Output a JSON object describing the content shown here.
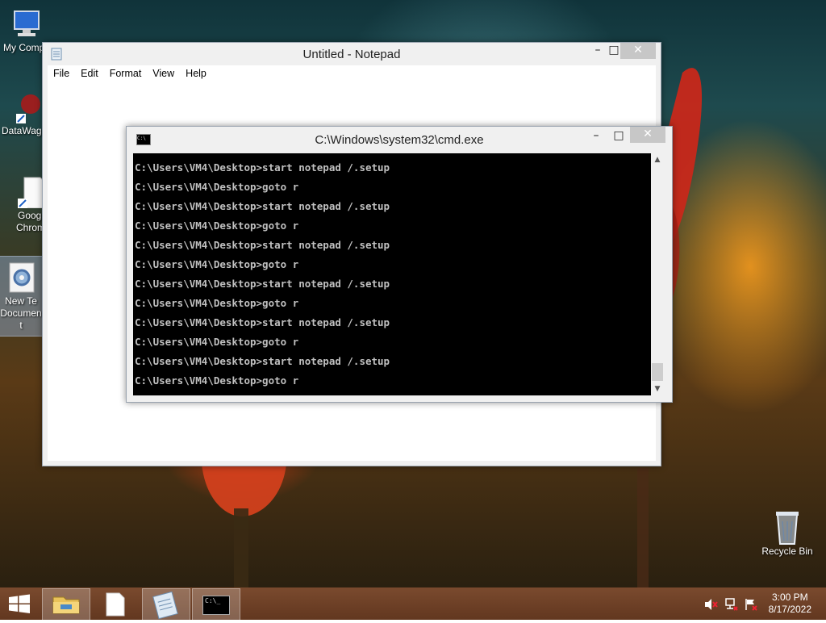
{
  "desktop": {
    "icons": [
      {
        "label": "My Comp",
        "icon": "computer-icon"
      },
      {
        "label": "DataWag",
        "icon": "datawag-shortcut-icon"
      },
      {
        "label_line1": "Googl",
        "label_line2": "Chrom",
        "icon": "chrome-shortcut-icon"
      },
      {
        "label_line1": "New Te",
        "label_line2": "Documen",
        "label_line3": "t",
        "icon": "text-document-gear-icon"
      },
      {
        "label": "Recycle Bin",
        "icon": "recycle-bin-icon"
      }
    ]
  },
  "notepad": {
    "title": "Untitled - Notepad",
    "menu": [
      "File",
      "Edit",
      "Format",
      "View",
      "Help"
    ],
    "controls": {
      "minimize": "–",
      "maximize": "□",
      "close": "✕"
    },
    "content": ""
  },
  "cmd": {
    "title": "C:\\Windows\\system32\\cmd.exe",
    "icon_text": "C:\\",
    "controls": {
      "minimize": "–",
      "maximize": "□",
      "close": "✕"
    },
    "lines": [
      "C:\\Users\\VM4\\Desktop>start notepad /.setup",
      "C:\\Users\\VM4\\Desktop>goto r",
      "C:\\Users\\VM4\\Desktop>start notepad /.setup",
      "C:\\Users\\VM4\\Desktop>goto r",
      "C:\\Users\\VM4\\Desktop>start notepad /.setup",
      "C:\\Users\\VM4\\Desktop>goto r",
      "C:\\Users\\VM4\\Desktop>start notepad /.setup",
      "C:\\Users\\VM4\\Desktop>goto r",
      "C:\\Users\\VM4\\Desktop>start notepad /.setup",
      "C:\\Users\\VM4\\Desktop>goto r",
      "C:\\Users\\VM4\\Desktop>start notepad /.setup",
      "C:\\Users\\VM4\\Desktop>goto r"
    ],
    "scroll_up": "▲",
    "scroll_down": "▼"
  },
  "taskbar": {
    "buttons": [
      "start-button",
      "file-explorer",
      "blank-document",
      "notepad",
      "cmd"
    ],
    "cmd_button_text": "C:\\_",
    "clock": {
      "time": "3:00 PM",
      "date": "8/17/2022"
    },
    "tray_icons": [
      "volume-muted-icon",
      "network-icon",
      "action-center-flag-icon"
    ]
  }
}
